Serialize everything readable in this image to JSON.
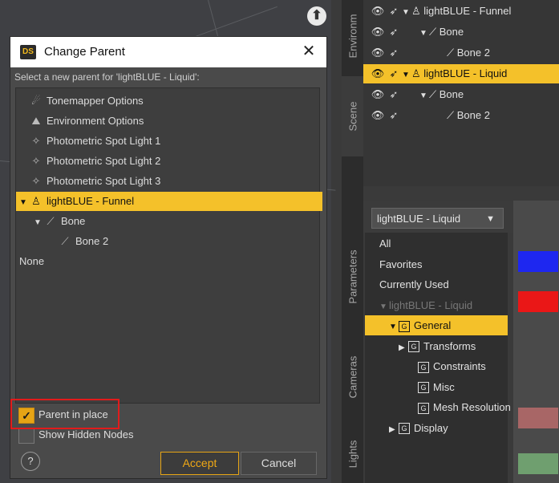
{
  "dialog": {
    "title": "Change Parent",
    "app_badge": "DS",
    "close_glyph": "✕",
    "subtitle": "Select a new parent for 'lightBLUE - Liquid':",
    "tree": [
      {
        "label": "Tonemapper Options",
        "icon": "tonemapper-icon",
        "glyph": "☄",
        "indent": 0,
        "arrow": "",
        "selected": false
      },
      {
        "label": "Environment Options",
        "icon": "environment-icon",
        "glyph": "⛰",
        "indent": 0,
        "arrow": "",
        "selected": false
      },
      {
        "label": "Photometric Spot Light 1",
        "icon": "spotlight-icon",
        "glyph": "✧",
        "indent": 0,
        "arrow": "",
        "selected": false
      },
      {
        "label": "Photometric Spot Light 2",
        "icon": "spotlight-icon",
        "glyph": "✧",
        "indent": 0,
        "arrow": "",
        "selected": false
      },
      {
        "label": "Photometric Spot Light 3",
        "icon": "spotlight-icon",
        "glyph": "✧",
        "indent": 0,
        "arrow": "",
        "selected": false
      },
      {
        "label": "lightBLUE - Funnel",
        "icon": "figure-icon",
        "glyph": "♙",
        "indent": 0,
        "arrow": "▼",
        "selected": true
      },
      {
        "label": "Bone",
        "icon": "bone-icon",
        "glyph": "⟋",
        "indent": 1,
        "arrow": "▼",
        "selected": false
      },
      {
        "label": "Bone 2",
        "icon": "bone-icon",
        "glyph": "⟋",
        "indent": 2,
        "arrow": "",
        "selected": false
      },
      {
        "label": "None",
        "icon": "",
        "glyph": "",
        "indent": 0,
        "arrow": "",
        "selected": false
      }
    ],
    "parent_in_place": {
      "label": "Parent in place",
      "checked": true,
      "check_glyph": "✓"
    },
    "show_hidden_nodes": {
      "label": "Show Hidden Nodes",
      "checked": false
    },
    "help_glyph": "?",
    "accept_label": "Accept",
    "cancel_label": "Cancel",
    "accent_color": "#f4c12a",
    "highlight_color": "#e21b1b"
  },
  "viewport": {
    "nav_glyph": "⬆"
  },
  "side_tabs": {
    "environment": "Environm",
    "scene": "Scene",
    "parameters": "Parameters",
    "cameras": "Cameras",
    "lights": "Lights"
  },
  "scene": {
    "rows": [
      {
        "label": "lightBLUE - Funnel",
        "arrow": "▼",
        "glyph": "♙",
        "icon": "figure-icon",
        "indent": 0,
        "selected": false
      },
      {
        "label": "Bone",
        "arrow": "▼",
        "glyph": "⟋",
        "icon": "bone-icon",
        "indent": 1,
        "selected": false
      },
      {
        "label": "Bone 2",
        "arrow": "",
        "glyph": "⟋",
        "icon": "bone-icon",
        "indent": 2,
        "selected": false
      },
      {
        "label": "lightBLUE - Liquid",
        "arrow": "▼",
        "glyph": "♙",
        "icon": "figure-icon",
        "indent": 0,
        "selected": true
      },
      {
        "label": "Bone",
        "arrow": "▼",
        "glyph": "⟋",
        "icon": "bone-icon",
        "indent": 1,
        "selected": false
      },
      {
        "label": "Bone 2",
        "arrow": "",
        "glyph": "⟋",
        "icon": "bone-icon",
        "indent": 2,
        "selected": false
      }
    ]
  },
  "parameters": {
    "node_select": "lightBLUE - Liquid",
    "node_select_arrow": "▼",
    "list": [
      {
        "label": "All",
        "box": "",
        "arrow": "",
        "indent": 0,
        "selected": false,
        "dim": false
      },
      {
        "label": "Favorites",
        "box": "",
        "arrow": "",
        "indent": 0,
        "selected": false,
        "dim": false
      },
      {
        "label": "Currently Used",
        "box": "",
        "arrow": "",
        "indent": 0,
        "selected": false,
        "dim": false
      },
      {
        "label": "lightBLUE - Liquid",
        "box": "",
        "arrow": "▼",
        "indent": 0,
        "selected": false,
        "dim": true
      },
      {
        "label": "General",
        "box": "G",
        "arrow": "▼",
        "indent": 1,
        "selected": true,
        "dim": false
      },
      {
        "label": "Transforms",
        "box": "G",
        "arrow": "▶",
        "indent": 2,
        "selected": false,
        "dim": false
      },
      {
        "label": "Constraints",
        "box": "G",
        "arrow": "",
        "indent": 3,
        "selected": false,
        "dim": false
      },
      {
        "label": "Misc",
        "box": "G",
        "arrow": "",
        "indent": 3,
        "selected": false,
        "dim": false
      },
      {
        "label": "Mesh Resolution",
        "box": "G",
        "arrow": "",
        "indent": 3,
        "selected": false,
        "dim": false
      },
      {
        "label": "Display",
        "box": "G",
        "arrow": "▶",
        "indent": 1,
        "selected": false,
        "dim": false
      }
    ]
  }
}
